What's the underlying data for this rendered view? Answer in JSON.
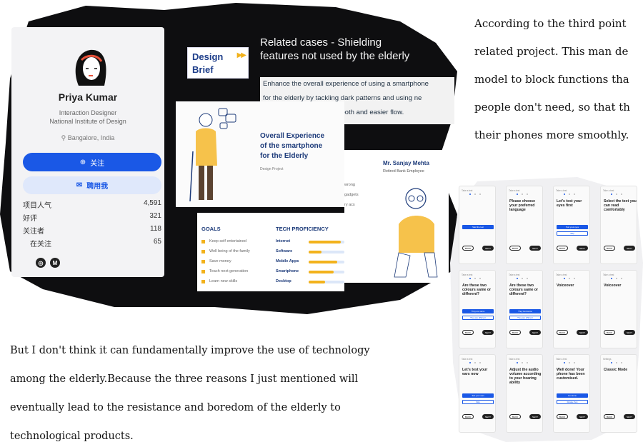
{
  "profile": {
    "name": "Priya Kumar",
    "role": "Interaction Designer",
    "school": "National Institute of Design",
    "location": "Bangalore, India",
    "follow_label": "关注",
    "hire_label": "聘用我",
    "stats": [
      {
        "label": "项目人气",
        "value": "4,591"
      },
      {
        "label": "好评",
        "value": "321"
      },
      {
        "label": "关注者",
        "value": "118"
      },
      {
        "label": "在关注",
        "value": "65"
      }
    ],
    "social_icons": [
      "globe-icon",
      "medium-icon"
    ],
    "social_glyphs": [
      "◎",
      "M"
    ]
  },
  "brief": {
    "label_line1": "Design",
    "label_line2": "Brief",
    "arrows": "▶▶",
    "related_line1": "Related cases - Shielding",
    "related_line2": "features not used by the elderly",
    "desc_line1": "Enhance the overall experience of using a smartphone",
    "desc_line2": "for the elderly by tackling dark patterns and using ne",
    "desc_line3": "technologies to create smooth and easier flow."
  },
  "slide": {
    "title_line1": "Overall Experience",
    "title_line2": "of the smartphone",
    "title_line3": "for the Elderly",
    "subtitle": "Design Project"
  },
  "persona": {
    "name": "Mr. Sanjay Mehta",
    "role": "Retired Bank Employee",
    "fragments": [
      "wrong",
      "gadgets",
      "ry acs"
    ]
  },
  "goals": {
    "title": "GOALS",
    "items": [
      "Keep self entertained",
      "Well being of the family",
      "Save money",
      "Teach next generation",
      "Learn new skills"
    ]
  },
  "tech": {
    "title": "TECH PROFICIENCY",
    "items": [
      {
        "label": "Internet",
        "level": 0.9
      },
      {
        "label": "Software",
        "level": 0.35
      },
      {
        "label": "Mobile Apps",
        "level": 0.8
      },
      {
        "label": "Smartphone",
        "level": 0.7
      },
      {
        "label": "Desktop",
        "level": 0.45
      }
    ]
  },
  "right_text": [
    "According to the third point",
    "related project. This man de",
    "model to block functions tha",
    "people don't need, so that th",
    "their phones more smoothly."
  ],
  "bottom_text": [
    "But I don't think it can fundamentally improve the use of technology",
    "among the elderly.Because the three reasons I just mentioned will",
    "eventually lead to the resistance and boredom of the elderly to",
    "technological products."
  ],
  "phones": [
    {
      "top": "Take a test",
      "head": "",
      "btn": "Start the test",
      "btn2": ""
    },
    {
      "top": "Take a test",
      "head": "Please choose your preferred language",
      "btn": "",
      "btn2": ""
    },
    {
      "top": "Take a test",
      "head": "Let's test your eyes first",
      "btn": "Test your eyes",
      "btn2": "Skip"
    },
    {
      "top": "Take a test",
      "head": "Select the text you can read comfortably",
      "btn": "",
      "btn2": ""
    },
    {
      "top": "Take a test",
      "head": "Are these two colours same or different?",
      "btn": "They are same",
      "btn2": "They are different"
    },
    {
      "top": "Take a test",
      "head": "Are these two colours same or different?",
      "btn": "They look same",
      "btn2": "They are different"
    },
    {
      "top": "Take a test",
      "head": "Voiceover",
      "btn": "",
      "btn2": ""
    },
    {
      "top": "Take a test",
      "head": "Voiceover",
      "btn": "",
      "btn2": ""
    },
    {
      "top": "Take a test",
      "head": "Let's test your ears now",
      "btn": "Test your ears",
      "btn2": "Skip"
    },
    {
      "top": "Take a test",
      "head": "Adjust the audio volume according to your hearing ability",
      "btn": "",
      "btn2": ""
    },
    {
      "top": "Take a test",
      "head": "Well done! Your phone has been customised.",
      "btn": "Go Home",
      "btn2": "Retake Test"
    },
    {
      "top": "Settings",
      "head": "Classic Mode",
      "btn": "",
      "btn2": ""
    }
  ],
  "phone_nav": {
    "back": "BACK",
    "next": "NEXT"
  },
  "phone_voiceover_extra": "Voiceover speaks items on your screen",
  "colors": {
    "accent_blue": "#1a58e6",
    "accent_yellow": "#f2b21c",
    "navy": "#1d3b7a"
  }
}
